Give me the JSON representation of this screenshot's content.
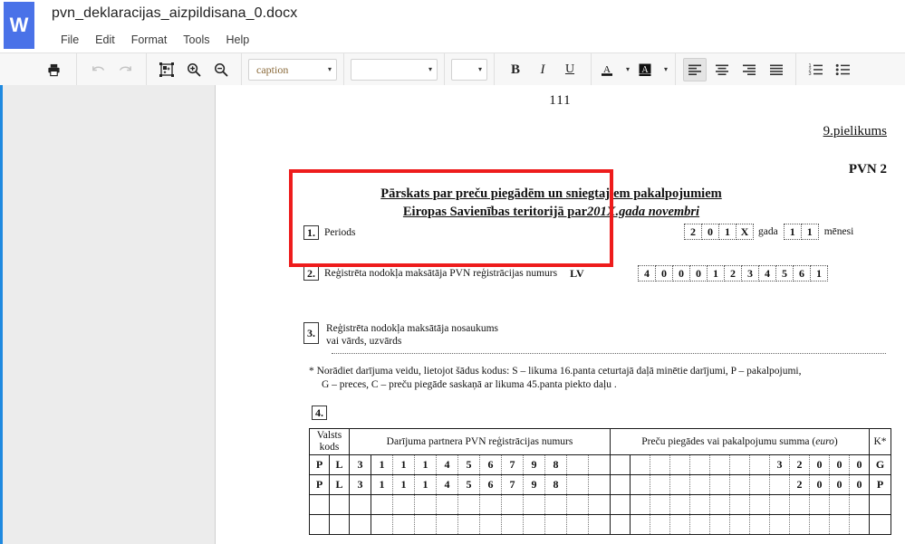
{
  "app": {
    "icon_letter": "W",
    "document_title": "pvn_deklaracijas_aizpildisana_0.docx",
    "menus": [
      "File",
      "Edit",
      "Format",
      "Tools",
      "Help"
    ]
  },
  "toolbar": {
    "print_label": "print-icon",
    "undo_label": "undo-icon",
    "redo_label": "redo-icon",
    "image_label": "image-crop-icon",
    "zoom_in_label": "zoom-in-icon",
    "zoom_out_label": "zoom-out-icon",
    "style_value": "caption",
    "font_value": "",
    "size_value": "",
    "bold_label": "B",
    "italic_label": "I",
    "underline_label": "U",
    "text_color_label": "A",
    "highlight_label": "A",
    "align_left_label": "align-left-icon",
    "align_center_label": "align-center-icon",
    "align_right_label": "align-right-icon",
    "align_justify_label": "align-justify-icon",
    "numbered_list_label": "numbered-list-icon",
    "bulleted_list_label": "bulleted-list-icon",
    "caret": "▾"
  },
  "document": {
    "page_number": "111",
    "appendix": "9.pielikums",
    "form_code": "PVN 2",
    "title_line1": "Pārskats par preču piegādēm un sniegtajiem pakalpojumiem",
    "title_line2_prefix": "Eiropas Savienības teritorijā par",
    "title_line2_italic": "201X.gada novembri",
    "section1": {
      "number": "1.",
      "label": "Periods",
      "year_digits": [
        "2",
        "0",
        "1",
        "X"
      ],
      "year_word": "gada",
      "month_digits": [
        "1",
        "1"
      ],
      "month_word": "mēnesi"
    },
    "section2": {
      "number": "2.",
      "label": "Reģistrēta nodokļa maksātāja PVN reģistrācijas numurs",
      "country_code": "LV",
      "digits": [
        "4",
        "0",
        "0",
        "0",
        "1",
        "2",
        "3",
        "4",
        "5",
        "6",
        "1"
      ]
    },
    "section3": {
      "number": "3.",
      "label_line1": "Reģistrēta nodokļa maksātāja nosaukums",
      "label_line2": "vai vārds, uzvārds"
    },
    "footnote_line1": "* Norādiet darījuma veidu, lietojot šādus kodus: S – likuma 16.panta ceturtajā daļā minētie darījumi, P – pakalpojumi,",
    "footnote_line2": "G – preces, C – preču piegāde saskaņā ar likuma 45.panta piekto daļu .",
    "section4": {
      "number": "4."
    },
    "table": {
      "headers": {
        "country_code": "Valsts kods",
        "partner_vat": "Darījuma partnera PVN reģistrācijas numurs",
        "amount": "Preču piegādes vai pakalpojumu summa (",
        "amount_unit": "euro",
        "amount_suffix": ")",
        "code": "K*"
      },
      "rows": [
        {
          "country": [
            "P",
            "L"
          ],
          "vat": [
            "3",
            "1",
            "1",
            "1",
            "4",
            "5",
            "6",
            "7",
            "9",
            "8",
            "",
            ""
          ],
          "amount": [
            "",
            "",
            "",
            "",
            "",
            "",
            "",
            "",
            "3",
            "2",
            "0",
            "0",
            "0"
          ],
          "code": "G"
        },
        {
          "country": [
            "P",
            "L"
          ],
          "vat": [
            "3",
            "1",
            "1",
            "1",
            "4",
            "5",
            "6",
            "7",
            "9",
            "8",
            "",
            ""
          ],
          "amount": [
            "",
            "",
            "",
            "",
            "",
            "",
            "",
            "",
            "",
            "2",
            "0",
            "0",
            "0"
          ],
          "code": "P"
        },
        {
          "country": [
            "",
            ""
          ],
          "vat": [
            "",
            "",
            "",
            "",
            "",
            "",
            "",
            "",
            "",
            "",
            "",
            ""
          ],
          "amount": [
            "",
            "",
            "",
            "",
            "",
            "",
            "",
            "",
            "",
            "",
            "",
            "",
            ""
          ],
          "code": ""
        },
        {
          "country": [
            "",
            ""
          ],
          "vat": [
            "",
            "",
            "",
            "",
            "",
            "",
            "",
            "",
            "",
            "",
            "",
            ""
          ],
          "amount": [
            "",
            "",
            "",
            "",
            "",
            "",
            "",
            "",
            "",
            "",
            "",
            "",
            ""
          ],
          "code": ""
        }
      ]
    }
  },
  "annotation": {
    "highlight_color": "#ee1c1c"
  }
}
